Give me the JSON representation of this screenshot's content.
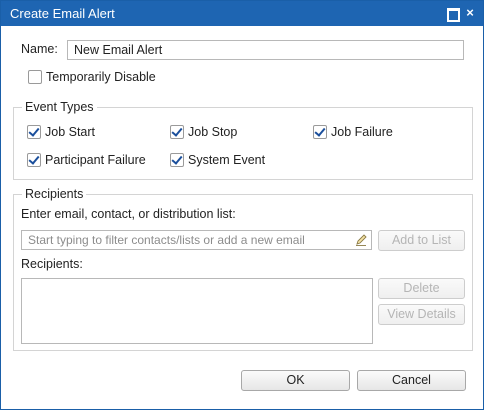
{
  "window": {
    "title": "Create Email Alert",
    "maximize_icon": "maximize-icon",
    "close_label": "×"
  },
  "name_field": {
    "label": "Name:",
    "value": "New Email Alert"
  },
  "temporarily_disable": {
    "label": "Temporarily Disable",
    "checked": false
  },
  "event_types": {
    "legend": "Event Types",
    "items": [
      {
        "label": "Job Start",
        "checked": true
      },
      {
        "label": "Job Stop",
        "checked": true
      },
      {
        "label": "Job Failure",
        "checked": true
      },
      {
        "label": "Participant Failure",
        "checked": true
      },
      {
        "label": "System Event",
        "checked": true
      }
    ]
  },
  "recipients_group": {
    "legend": "Recipients",
    "entry_label": "Enter email, contact, or distribution list:",
    "entry_placeholder": "Start typing to filter contacts/lists or add a new email",
    "add_button": "Add to List",
    "list_label": "Recipients:",
    "delete_button": "Delete",
    "view_details_button": "View Details"
  },
  "footer": {
    "ok_button": "OK",
    "cancel_button": "Cancel"
  },
  "colors": {
    "titlebar": "#1e65b2",
    "checkmark": "#1b4f9c"
  }
}
